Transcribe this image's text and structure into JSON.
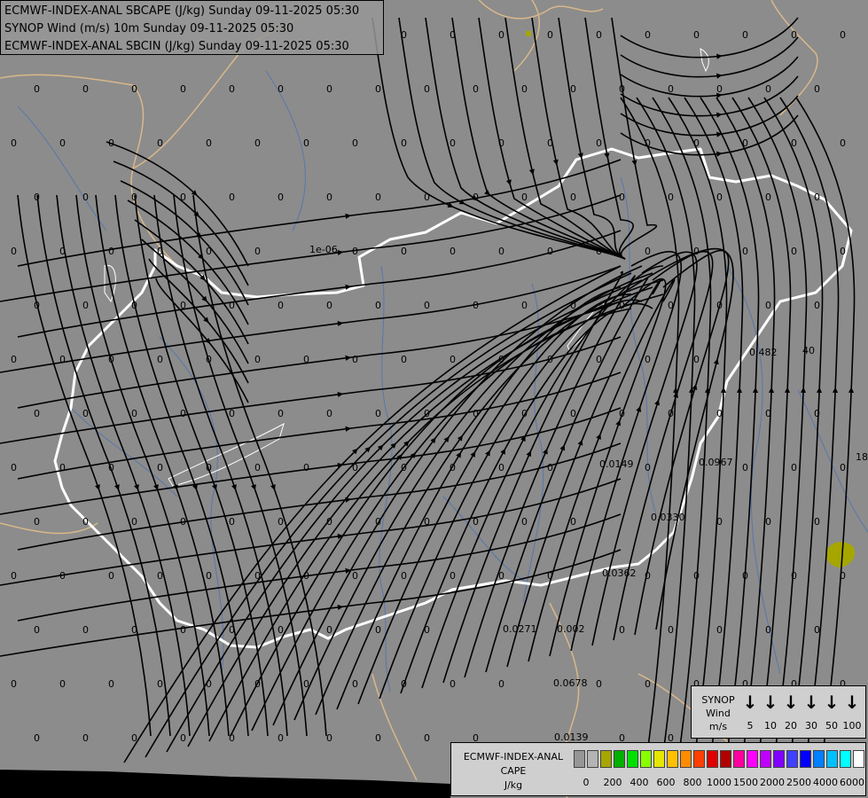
{
  "header": {
    "line1": "ECMWF-INDEX-ANAL SBCAPE (J/kg) Sunday 09-11-2025 05:30",
    "line2": "SYNOP Wind (m/s) 10m Sunday 09-11-2025 05:30",
    "line3": "ECMWF-INDEX-ANAL SBCIN (J/kg) Sunday 09-11-2025 05:30"
  },
  "colors": {
    "background": "#8c8c8c",
    "streamline": "#000000",
    "national_border": "#ffffff",
    "regional_border": "#d9b88a",
    "rivers": "#4f73b0",
    "cape_patch": "#a6a600"
  },
  "field_labels": {
    "zero": "0",
    "cape_values": [
      "1e-06",
      "0.482",
      "0.0967",
      "0.0149",
      "0.0330",
      "0.0362",
      "0.0271",
      "0.002",
      "0.0678",
      "0.0139",
      "40",
      "18"
    ]
  },
  "wind_legend": {
    "title_line1": "SYNOP",
    "title_line2": "Wind",
    "unit": "m/s",
    "speeds": [
      "5",
      "10",
      "20",
      "30",
      "50",
      "100"
    ],
    "arrow_glyph": "↓"
  },
  "cape_legend": {
    "title_line1": "ECMWF-INDEX-ANAL",
    "title_line2": "CAPE",
    "unit": "J/kg",
    "ticks": [
      "0",
      "200",
      "400",
      "600",
      "800",
      "1000",
      "1500",
      "2000",
      "2500",
      "4000",
      "6000"
    ],
    "colors": [
      "#969696",
      "#b4b4b4",
      "#a6a600",
      "#00b000",
      "#00e000",
      "#88ff00",
      "#e6e600",
      "#ffc000",
      "#ff8c00",
      "#ff4000",
      "#e00000",
      "#b00000",
      "#ff00a0",
      "#ff00ff",
      "#c000ff",
      "#8000ff",
      "#4040ff",
      "#0000ff",
      "#0080ff",
      "#00c0ff",
      "#00ffff",
      "#ffffff"
    ]
  }
}
